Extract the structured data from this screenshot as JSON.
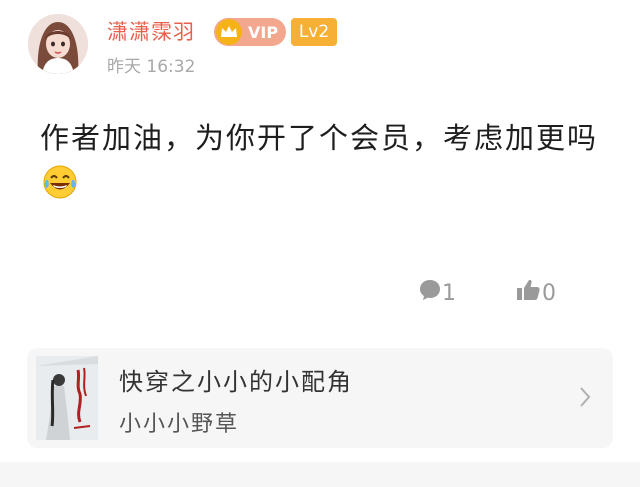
{
  "colors": {
    "username": "#e8604c",
    "vip_badge_bg": "#f3a78e",
    "crown": "#f5b317",
    "level_badge_bg": "#f5b035",
    "muted": "#a8a8a8",
    "card_bg": "#f6f6f6"
  },
  "comment": {
    "username": "潇潇霂羽",
    "vip_label": "VIP",
    "level_label": "Lv2",
    "timestamp": "昨天 16:32",
    "text": "作者加油，为你开了个会员，考虑加更吗",
    "emoji": "laughing-tears-emoji"
  },
  "actions": {
    "reply_icon": "comment-bubble-icon",
    "reply_count": "1",
    "like_icon": "thumbs-up-icon",
    "like_count": "0"
  },
  "book": {
    "title": "快穿之小小的小配角",
    "author": "小小小野草",
    "chevron_icon": "chevron-right-icon"
  }
}
